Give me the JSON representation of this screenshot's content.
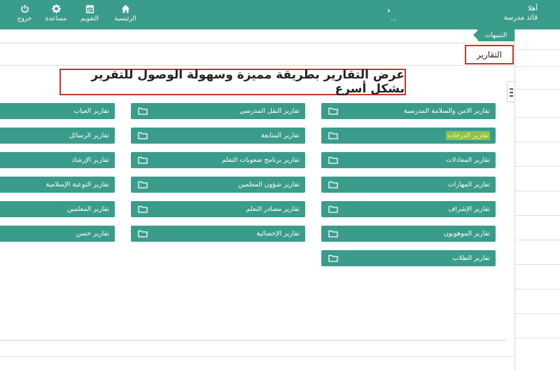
{
  "topbar": {
    "greeting_line1": "أهلا",
    "greeting_line2": "قائد مدرسة",
    "dots": "...",
    "nav": {
      "home": "الرئيسية",
      "calendar": "التقويم",
      "help": "مساعدة",
      "logout": "خروج"
    }
  },
  "notifications_label": "التنبيهات",
  "section_title": "التقارير",
  "banner_text": "عرض التقارير بطريقة مميزة وسهولة الوصول للتقرير بشكل أسرع",
  "reports": {
    "col1": [
      "تقارير الامن والسلامة المدرسية",
      "تقارير الدرجات",
      "تقارير المعادلات",
      "تقارير المهارات",
      "تقارير الإشراف",
      "تقارير الموهوبون",
      "تقارير الطلاب"
    ],
    "col2": [
      "تقارير النقل المدرسي",
      "تقارير المتابعة",
      "تقارير برنامج صعوبات التعلم",
      "تقارير شؤون المعلمين",
      "تقارير مصادر التعلم",
      "تقارير الإحصائية"
    ],
    "col3": [
      "تقارير الغياب",
      "تقارير الرسائل",
      "تقارير الإرشاد",
      "تقارير التوعية الإسلامية",
      "تقارير المعلمين",
      "تقارير حسن"
    ]
  },
  "colors": {
    "primary": "#3a9d8b",
    "highlight": "#8bc34a",
    "annotation_border": "#c0392b"
  }
}
